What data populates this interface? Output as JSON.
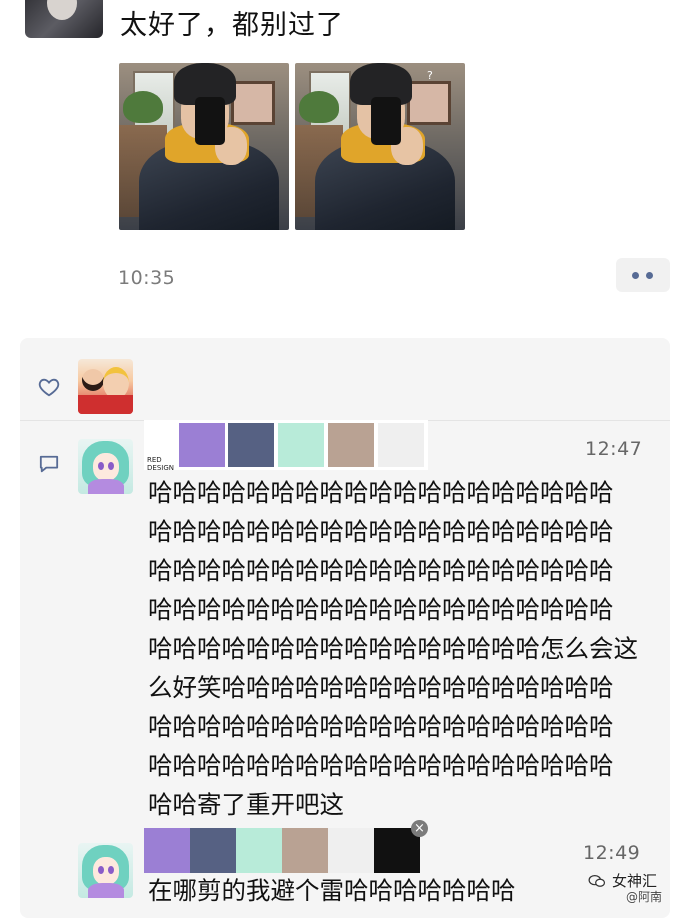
{
  "post": {
    "text": "太好了，都别过了",
    "time": "10:35",
    "photos": [
      {
        "alt_icon": "photo-icon",
        "annotation": ""
      },
      {
        "alt_icon": "photo-icon",
        "annotation": "?"
      }
    ]
  },
  "interactions": {
    "like_icon": "heart-outline-icon",
    "comment_icon": "comment-bubble-icon"
  },
  "comments": [
    {
      "time": "12:47",
      "palette_brand_line1": "RED",
      "palette_brand_line2": "DESIGN",
      "palette_colors": [
        "#9b7fd4",
        "#566183",
        "#b8ebd9",
        "#b9a293",
        "#efefef"
      ],
      "lines": [
        "哈哈哈哈哈哈哈哈哈哈哈哈哈哈哈哈哈哈哈",
        "哈哈哈哈哈哈哈哈哈哈哈哈哈哈哈哈哈哈哈",
        "哈哈哈哈哈哈哈哈哈哈哈哈哈哈哈哈哈哈哈",
        "哈哈哈哈哈哈哈哈哈哈哈哈哈哈哈哈哈哈哈",
        "哈哈哈哈哈哈哈哈哈哈哈哈哈哈哈哈怎么会这",
        "么好笑哈哈哈哈哈哈哈哈哈哈哈哈哈哈哈哈",
        "哈哈哈哈哈哈哈哈哈哈哈哈哈哈哈哈哈哈哈",
        "哈哈哈哈哈哈哈哈哈哈哈哈哈哈哈哈哈哈哈",
        "哈哈寄了重开吧这"
      ]
    },
    {
      "time": "12:49",
      "palette_colors": [
        "#9b7fd4",
        "#566183",
        "#b8ebd9",
        "#b9a293",
        "#efefef",
        "#111111"
      ],
      "close_label": "×",
      "text": "在哪剪的我避个雷哈哈哈哈哈哈哈"
    }
  ],
  "watermark": {
    "line1": "女神汇",
    "line2": "@阿南"
  },
  "colors": {
    "link_blue": "#576b95",
    "panel_bg": "#f5f5f5",
    "time_gray": "#7b7b7b"
  }
}
